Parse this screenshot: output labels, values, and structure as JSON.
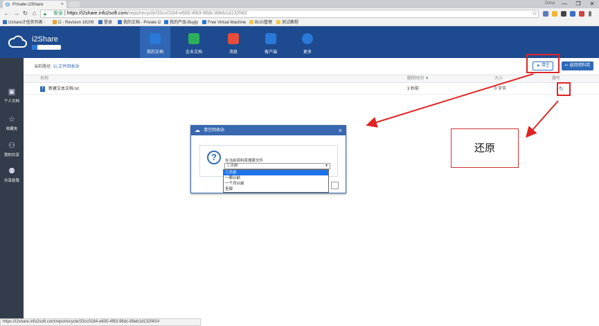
{
  "browser": {
    "tab_title": "Private i2Share",
    "tab_close": "×",
    "window_user": "Dima",
    "window_controls": [
      "—",
      "❐",
      "✕"
    ],
    "url_secure_label": "安全",
    "url_host": "https://i2share.info2soft.com",
    "url_path": "/repo/recycle/33cc0184-e600-4f83-96dc-88eb1d132f40/",
    "bookmarks": [
      "i2share计任务列表 - ",
      "i2 - Revision 19209",
      "登录",
      "我的文档 - Private i2",
      "我的产品-Bugly",
      "Free Virtual Machine",
      "BUG管理",
      "测试教程"
    ],
    "status_url": "https://i2share.info2soft.com/repo/recycle/33cc0184-e600-4f83-96dc-88eb1d132f40/#"
  },
  "app": {
    "brand": "i2Share",
    "quota_text": "20/100",
    "quota_fraction": 0.2,
    "nav": [
      {
        "label": "我的文档",
        "icon": "user-doc-icon",
        "color": "#2a78d8"
      },
      {
        "label": "企业文档",
        "icon": "enterprise-icon",
        "color": "#2eaf5c"
      },
      {
        "label": "消息",
        "icon": "paper-plane-icon",
        "color": "#e84c3d"
      },
      {
        "label": "客户端",
        "icon": "monitor-icon",
        "color": "#2a78d8"
      },
      {
        "label": "更多",
        "icon": "more-icon",
        "color": "#2a78d8"
      }
    ],
    "sidebar": [
      {
        "label": "个人文档",
        "icon": "document-icon"
      },
      {
        "label": "收藏夹",
        "icon": "star-icon"
      },
      {
        "label": "我的共享",
        "icon": "share-user-icon"
      },
      {
        "label": "共享给我",
        "icon": "shared-with-me-icon"
      }
    ]
  },
  "content": {
    "breadcrumb_label": "当前路径:",
    "breadcrumb_link": "11.文件回收站",
    "clear_button": "清空",
    "back_button": "返回资料库",
    "columns": {
      "name": "名称",
      "deleted_time": "删除时间 ▼",
      "size": "大小",
      "ops": "操作"
    },
    "rows": [
      {
        "name": "新建文本文档.txt",
        "deleted_time": "3 秒前",
        "size": "0 字节"
      }
    ]
  },
  "dialog": {
    "title": "清空回收站",
    "close": "×",
    "prompt": "在当前资料库搜索文件",
    "selected": "三天前",
    "options": [
      "三天前",
      "一周以前",
      "一个月以前",
      "全部"
    ]
  },
  "annotation": {
    "callout_text": "还原"
  }
}
